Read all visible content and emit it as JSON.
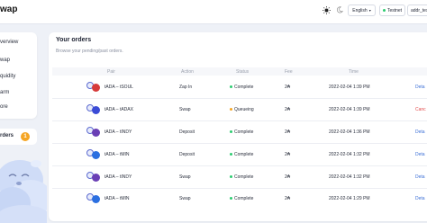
{
  "header": {
    "logo_text": "wap",
    "language": "English",
    "network": "Testnet",
    "address": "addr_tes"
  },
  "sidebar": {
    "items": [
      {
        "label": "verview"
      },
      {
        "label": "wap"
      },
      {
        "label": "quidity"
      },
      {
        "label": "arm"
      },
      {
        "label": "ore"
      }
    ],
    "orders_label": "rders",
    "orders_count": "1"
  },
  "orders": {
    "title": "Your orders",
    "subtitle": "Browse your pending/past orders.",
    "columns": [
      "Pair",
      "Action",
      "Status",
      "Fee",
      "Time"
    ],
    "rows": [
      {
        "pair": "tADA – tSOUL",
        "action": "Zap In",
        "status": "Complete",
        "status_color": "#2ecc71",
        "fee": "2₳",
        "time": "2022-02-04 1:39 PM",
        "link": "Deta",
        "link_color": "#3b6fd6",
        "token_color": "#d63a3a"
      },
      {
        "pair": "tADA – tADAX",
        "action": "Swap",
        "status": "Queueing",
        "status_color": "#f5a524",
        "fee": "2₳",
        "time": "2022-02-04 1:39 PM",
        "link": "Canc",
        "link_color": "#e24b4b",
        "token_color": "#3b4bd6"
      },
      {
        "pair": "tADA – tINDY",
        "action": "Deposit",
        "status": "Complete",
        "status_color": "#2ecc71",
        "fee": "2₳",
        "time": "2022-02-04 1:36 PM",
        "link": "Deta",
        "link_color": "#3b6fd6",
        "token_color": "#6a3fb5"
      },
      {
        "pair": "tADA – tMIN",
        "action": "Deposit",
        "status": "Complete",
        "status_color": "#2ecc71",
        "fee": "2₳",
        "time": "2022-02-04 1:32 PM",
        "link": "Deta",
        "link_color": "#3b6fd6",
        "token_color": "#2b6fe0"
      },
      {
        "pair": "tADA – tINDY",
        "action": "Swap",
        "status": "Complete",
        "status_color": "#2ecc71",
        "fee": "2₳",
        "time": "2022-02-04 1:32 PM",
        "link": "Deta",
        "link_color": "#3b6fd6",
        "token_color": "#6a3fb5"
      },
      {
        "pair": "tADA – tMIN",
        "action": "Swap",
        "status": "Complete",
        "status_color": "#2ecc71",
        "fee": "2₳",
        "time": "2022-02-04 1:29 PM",
        "link": "Deta",
        "link_color": "#3b6fd6",
        "token_color": "#2b6fe0"
      }
    ]
  }
}
